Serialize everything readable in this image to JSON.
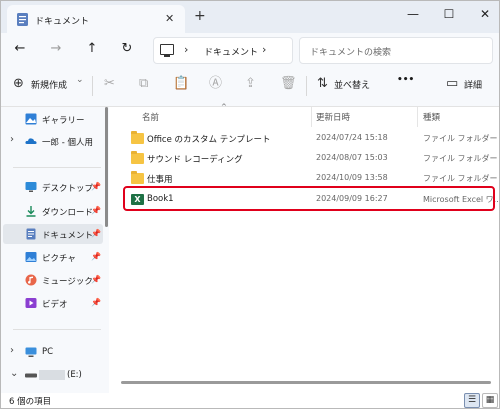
{
  "window": {
    "tab_title": "ドキュメント",
    "tab_close": "✕",
    "new_tab": "+",
    "minimize": "—",
    "maximize": "☐",
    "close": "✕"
  },
  "nav": {
    "back": "←",
    "forward": "→",
    "up": "↑",
    "refresh": "↻",
    "breadcrumb_sep": "›",
    "breadcrumb": "ドキュメント",
    "search_placeholder": "ドキュメントの検索"
  },
  "commands": {
    "new_icon": "⊕",
    "new_label": "新規作成",
    "new_chevron": "⌄",
    "cut_icon": "✂",
    "copy_icon": "⧉",
    "paste_icon": "📋",
    "rename_icon": "Ⓐ",
    "share_icon": "⇪",
    "delete_icon": "🗑",
    "sort_icon": "⇅",
    "sort_label": "並べ替え",
    "more": "•••",
    "details_icon": "▭",
    "details_label": "詳細"
  },
  "sidebar": {
    "items": [
      {
        "label": "ギャラリー",
        "icon": "gallery-icon"
      },
      {
        "label": "一郎 - 個人用",
        "icon": "onedrive-icon",
        "chevron": "›"
      },
      {
        "label": "デスクトップ",
        "icon": "desktop-icon",
        "pin": "📌"
      },
      {
        "label": "ダウンロード",
        "icon": "download-icon",
        "pin": "📌"
      },
      {
        "label": "ドキュメント",
        "icon": "documents-icon",
        "pin": "📌",
        "selected": true
      },
      {
        "label": "ピクチャ",
        "icon": "pictures-icon",
        "pin": "📌"
      },
      {
        "label": "ミュージック",
        "icon": "music-icon",
        "pin": "📌"
      },
      {
        "label": "ビデオ",
        "icon": "video-icon",
        "pin": "📌"
      },
      {
        "label": "PC",
        "icon": "pc-icon",
        "chevron": "›"
      },
      {
        "label": "(E:)",
        "icon": "drive-icon",
        "chevron": "⌄"
      }
    ]
  },
  "filelist": {
    "columns": {
      "name": "名前",
      "modified": "更新日時",
      "type": "種類"
    },
    "sort_arrow": "^",
    "rows": [
      {
        "name": "Office のカスタム テンプレート",
        "date": "2024/07/24 15:18",
        "type": "ファイル フォルダー",
        "icon": "folder-icon"
      },
      {
        "name": "サウンド レコーディング",
        "date": "2024/08/07 15:03",
        "type": "ファイル フォルダー",
        "icon": "folder-icon"
      },
      {
        "name": "仕事用",
        "date": "2024/10/09 13:58",
        "type": "ファイル フォルダー",
        "icon": "folder-icon"
      },
      {
        "name": "Book1",
        "date": "2024/09/09 16:27",
        "type": "Microsoft Excel ワ...",
        "icon": "excel-icon"
      }
    ]
  },
  "status": {
    "count": "6 個の項目",
    "details_view": "☰",
    "tiles_view": "▦"
  }
}
